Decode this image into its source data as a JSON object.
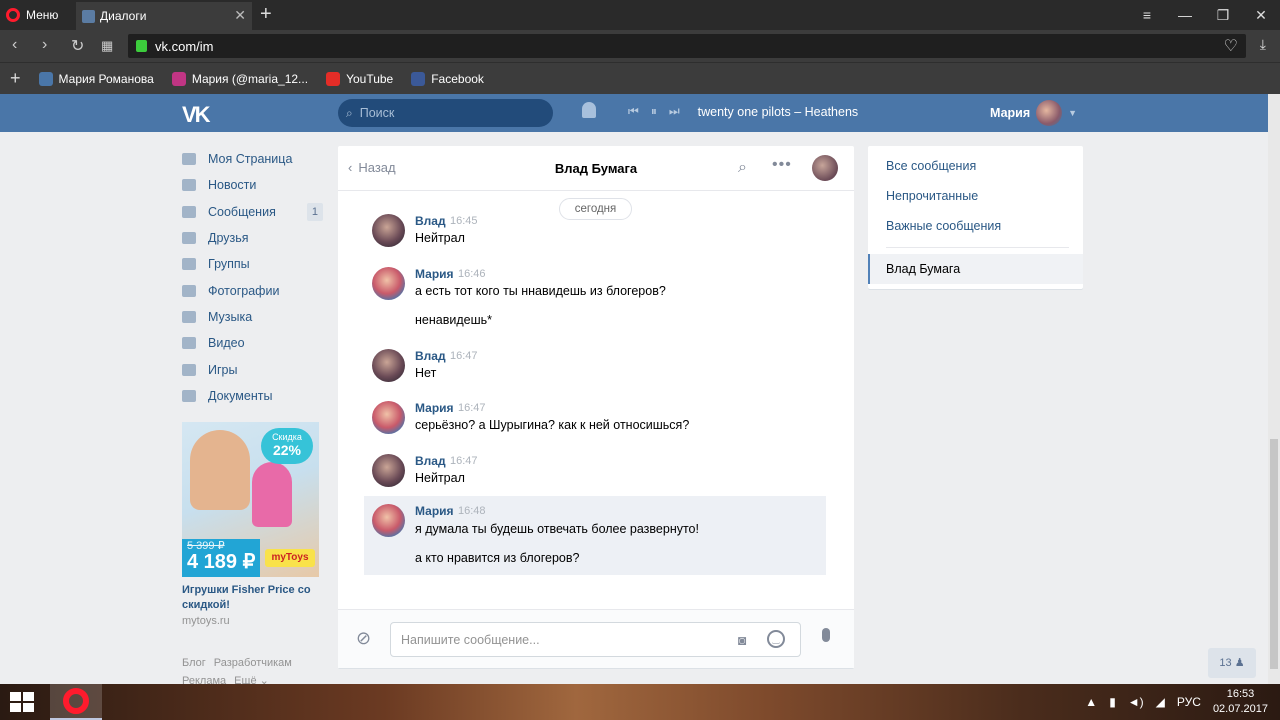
{
  "browser": {
    "menu_label": "Меню",
    "tab_title": "Диалоги",
    "url": "vk.com/im",
    "bookmarks": [
      {
        "label": "Мария Романова",
        "icon": "vk-icon",
        "color": "#4a76a8"
      },
      {
        "label": "Мария (@maria_12...",
        "icon": "instagram-icon",
        "color": "#c13584"
      },
      {
        "label": "YouTube",
        "icon": "youtube-icon",
        "color": "#e52d27"
      },
      {
        "label": "Facebook",
        "icon": "facebook-icon",
        "color": "#3b5998"
      }
    ]
  },
  "vk_header": {
    "logo": "VK",
    "search_placeholder": "Поиск",
    "track": "twenty one pilots – Heathens",
    "user_name": "Мария"
  },
  "left_nav": [
    {
      "label": "Моя Страница"
    },
    {
      "label": "Новости"
    },
    {
      "label": "Сообщения",
      "badge": "1"
    },
    {
      "label": "Друзья"
    },
    {
      "label": "Группы"
    },
    {
      "label": "Фотографии"
    },
    {
      "label": "Музыка"
    },
    {
      "label": "Видео"
    },
    {
      "label": "Игры"
    },
    {
      "label": "Документы"
    }
  ],
  "ad": {
    "sale_label": "Скидка",
    "sale_value": "22%",
    "old_price": "5 399 ₽",
    "new_price": "4 189 ₽",
    "brand": "myToys",
    "title": "Игрушки Fisher Price со скидкой!",
    "domain": "mytoys.ru"
  },
  "footer": {
    "links": [
      "Блог",
      "Разработчикам",
      "Реклама",
      "Ещё ⌄"
    ]
  },
  "chat": {
    "back_label": "Назад",
    "title": "Влад Бумага",
    "date_divider": "сегодня",
    "messages": [
      {
        "author": "Влад",
        "time": "16:45",
        "lines": [
          "Нейтрал"
        ],
        "avatar": "vlad"
      },
      {
        "author": "Мария",
        "time": "16:46",
        "lines": [
          "а есть тот кого ты ннавидешь из блогеров?",
          "ненавидешь*"
        ],
        "avatar": "maria"
      },
      {
        "author": "Влад",
        "time": "16:47",
        "lines": [
          "Нет"
        ],
        "avatar": "vlad"
      },
      {
        "author": "Мария",
        "time": "16:47",
        "lines": [
          "серьёзно? а Шурыгина? как к ней относишься?"
        ],
        "avatar": "maria"
      },
      {
        "author": "Влад",
        "time": "16:47",
        "lines": [
          "Нейтрал"
        ],
        "avatar": "vlad"
      },
      {
        "author": "Мария",
        "time": "16:48",
        "lines": [
          "я думала ты будешь отвечать более развернуто!",
          "а кто нравится из блогеров?"
        ],
        "avatar": "maria"
      }
    ],
    "input_placeholder": "Напишите сообщение..."
  },
  "right_menu": {
    "items": [
      "Все сообщения",
      "Непрочитанные",
      "Важные сообщения"
    ],
    "active": "Влад Бумага"
  },
  "online_count": "13",
  "taskbar": {
    "lang": "РУС",
    "time": "16:53",
    "date": "02.07.2017"
  },
  "colors": {
    "vk_blue": "#4a76a8",
    "link": "#2a5885",
    "opera_red": "#ff1b2d"
  }
}
